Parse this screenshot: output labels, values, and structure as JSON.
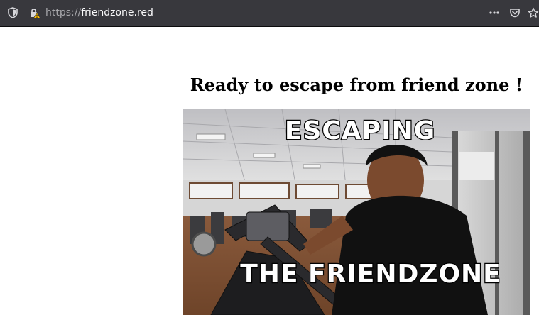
{
  "browser": {
    "url_scheme": "https://",
    "url_host": "friendzone.red",
    "icons": {
      "tracking": "shield-icon",
      "security": "lock-warning-icon",
      "page_actions": "more-dots-icon",
      "pocket": "pocket-icon",
      "bookmark": "star-icon"
    }
  },
  "page": {
    "heading": "Ready to escape from friend zone !",
    "image": {
      "top_caption": "ESCAPING",
      "bottom_caption": "THE FRIENDZONE"
    }
  },
  "colors": {
    "toolbar_bg": "#38383d",
    "url_text": "#f9f9fa",
    "url_scheme": "#a7a7ab",
    "warning": "#ffbf00"
  }
}
